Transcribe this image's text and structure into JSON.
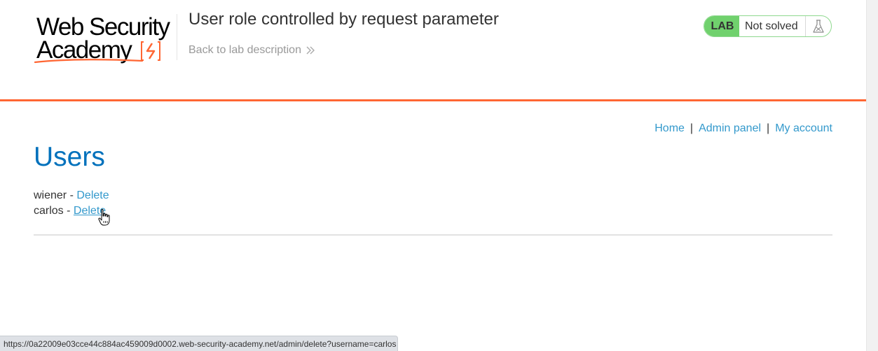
{
  "header": {
    "logo": {
      "line1": "Web Security",
      "line2": "Academy",
      "brand_color": "#ff6633"
    },
    "lab_title": "User role controlled by request parameter",
    "back_link": "Back to lab description",
    "lab_badge": {
      "label": "LAB",
      "status": "Not solved",
      "icon": "flask-icon",
      "accent_color": "#70d16d"
    }
  },
  "nav": {
    "home": "Home",
    "separator1": "|",
    "admin_panel": "Admin panel",
    "separator2": "|",
    "my_account": "My account"
  },
  "main": {
    "heading": "Users",
    "users": [
      {
        "name": "wiener",
        "sep": "-",
        "action": "Delete"
      },
      {
        "name": "carlos",
        "sep": "-",
        "action": "Delete"
      }
    ]
  },
  "status_bar": {
    "url": "https://0a22009e03cce44c884ac459009d0002.web-security-academy.net/admin/delete?username=carlos"
  },
  "colors": {
    "link": "#3399cc",
    "heading": "#0071bc",
    "header_border": "#ff6633"
  }
}
